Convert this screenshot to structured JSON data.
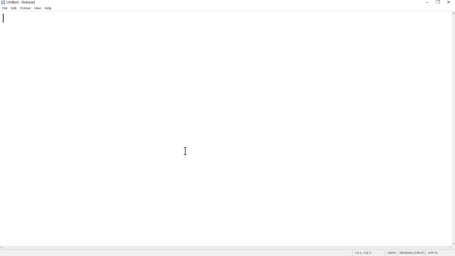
{
  "window": {
    "title": "Untitled - Notepad",
    "icon": "notepad-icon",
    "controls": {
      "minimize": "─",
      "maximize": "❐",
      "close": "✕"
    }
  },
  "menubar": {
    "items": [
      "File",
      "Edit",
      "Format",
      "View",
      "Help"
    ]
  },
  "editor": {
    "content": ""
  },
  "statusbar": {
    "position": "Ln 1, Col 1",
    "zoom": "100%",
    "line_ending": "Windows (CRLF)",
    "encoding": "UTF-8"
  },
  "cursor": {
    "type": "text-ibeam"
  }
}
